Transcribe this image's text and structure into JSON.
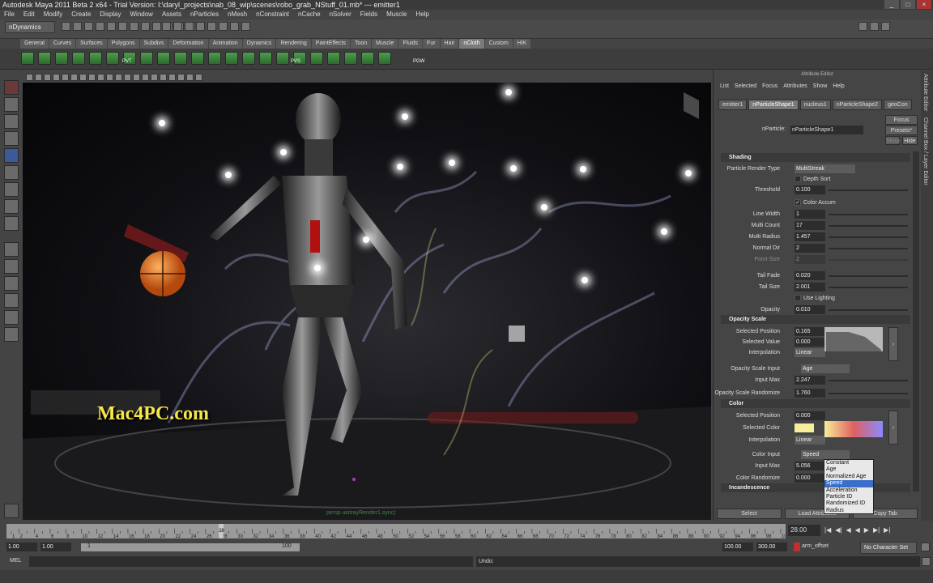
{
  "window": {
    "title": "Autodesk Maya 2011 Beta 2 x64 - Trial Version: I:\\daryl_projects\\nab_08_wip\\scenes\\robo_grab_NStuff_01.mb*  ---  emitter1",
    "min": "_",
    "max": "□",
    "close": "×"
  },
  "menubar": [
    "File",
    "Edit",
    "Modify",
    "Create",
    "Display",
    "Window",
    "Assets",
    "nParticles",
    "nMesh",
    "nConstraint",
    "nCache",
    "nSolver",
    "Fields",
    "Muscle",
    "Help"
  ],
  "menuset": "nDynamics",
  "shelf_tabs": [
    "General",
    "Curves",
    "Surfaces",
    "Polygons",
    "Subdivs",
    "Deformation",
    "Animation",
    "Dynamics",
    "Rendering",
    "PaintEffects",
    "Toon",
    "Muscle",
    "Fluids",
    "Fur",
    "Hair",
    "nCloth",
    "Custom",
    "HIK"
  ],
  "shelf_icons": {
    "pvt": "PVT",
    "pvs": "PVS",
    "pgw": "PGW"
  },
  "watermark": "Mac4PC.com",
  "viewport": {
    "camera_label": "persp  uistrayRender1.sync)"
  },
  "attr_editor": {
    "title": "Attribute Editor",
    "menu": [
      "List",
      "Selected",
      "Focus",
      "Attributes",
      "Show",
      "Help"
    ],
    "tabs": [
      "emitter1",
      "nParticleShape1",
      "nucleus1",
      "nParticleShape2",
      "geoCon"
    ],
    "node_label": "nParticle:",
    "node_value": "nParticleShape1",
    "focus": "Focus",
    "presets": "Presets*",
    "show": "Show",
    "hide": "Hide",
    "shading": {
      "title": "Shading",
      "render_type_label": "Particle Render Type",
      "render_type": "MultiStreak",
      "depth_sort": "Depth Sort",
      "threshold_label": "Threshold",
      "threshold": "0.100",
      "color_accum": "Color Accum",
      "line_width_label": "Line Width",
      "line_width": "1",
      "multi_count_label": "Multi Count",
      "multi_count": "17",
      "multi_radius_label": "Multi Radius",
      "multi_radius": "1.457",
      "normal_dir_label": "Normal Dir",
      "normal_dir": "2",
      "point_size_label": "Point Size",
      "point_size": "2",
      "tail_fade_label": "Tail Fade",
      "tail_fade": "0.020",
      "tail_size_label": "Tail Size",
      "tail_size": "2.001",
      "use_lighting": "Use Lighting",
      "opacity_label": "Opacity",
      "opacity": "0.010"
    },
    "opacity_scale": {
      "title": "Opacity Scale",
      "sel_pos_label": "Selected Position",
      "sel_pos": "0.165",
      "sel_val_label": "Selected Value",
      "sel_val": "0.000",
      "interp_label": "Interpolation",
      "interp": "Linear",
      "input_label": "Opacity Scale Input",
      "input": "Age",
      "input_max_label": "Input Max",
      "input_max": "2.247",
      "randomize_label": "Opacity Scale Randomize",
      "randomize": "1.760"
    },
    "color": {
      "title": "Color",
      "sel_pos_label": "Selected Position",
      "sel_pos": "0.000",
      "sel_color_label": "Selected Color",
      "interp_label": "Interpolation",
      "interp": "Linear",
      "input_label": "Color Input",
      "input": "Speed",
      "input_max_label": "Input Max",
      "input_max": "5.056",
      "randomize_label": "Color Randomize",
      "randomize": "0.000"
    },
    "incandescence": "Incandescence",
    "dropdown": [
      "Constant",
      "Age",
      "Normalized Age",
      "Speed",
      "Acceleration",
      "Particle ID",
      "Randomized ID",
      "Radius"
    ],
    "select": "Select",
    "load": "Load Attributes",
    "copy": "Copy Tab"
  },
  "sidetabs": {
    "ae": "Attribute Editor",
    "cb": "Channel Box / Layer Editor"
  },
  "timeline": {
    "ticks": [
      "1",
      "2",
      "4",
      "6",
      "8",
      "10",
      "12",
      "14",
      "16",
      "18",
      "20",
      "22",
      "24",
      "26",
      "28",
      "30",
      "32",
      "34",
      "36",
      "38",
      "40",
      "42",
      "44",
      "46",
      "48",
      "50",
      "52",
      "54",
      "56",
      "58",
      "60",
      "62",
      "64",
      "66",
      "68",
      "70",
      "72",
      "74",
      "76",
      "78",
      "80",
      "82",
      "84",
      "86",
      "88",
      "90",
      "92",
      "94",
      "96",
      "98",
      "100"
    ],
    "current": "28",
    "current_field": "28.00"
  },
  "range": {
    "start": "1.00",
    "start2": "1.00",
    "inner_start": "1",
    "inner_end": "100",
    "end": "100.00",
    "end2": "300.00",
    "anim_layer": "arm_offset",
    "char_set": "No Character Set"
  },
  "cmd": {
    "label": "MEL",
    "result": "Undo:"
  }
}
